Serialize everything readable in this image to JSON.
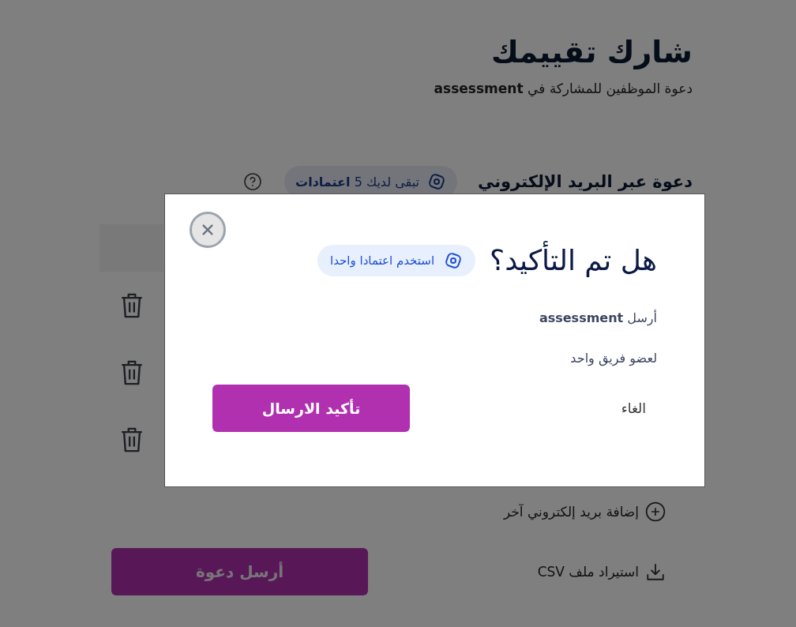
{
  "page": {
    "title": "شارك تقييمك",
    "subtitle": "دعوة الموظفين للمشاركة في **assessment**"
  },
  "email_section": {
    "heading": "دعوة عبر البريد الإلكتروني",
    "credits_badge": "تبقى لديك 5 **اعتمادات**",
    "rows": [
      {
        "kind": "header"
      },
      {
        "kind": "email"
      },
      {
        "kind": "email"
      },
      {
        "kind": "email"
      }
    ],
    "add_link": "إضافة بريد إلكتروني آخر",
    "import_link": "استيراد ملف CSV",
    "send_button": "أرسل دعوة"
  },
  "dialog": {
    "title": "هل تم التأكيد؟",
    "credit_badge": "استخدم اعتمادا واحدا",
    "lines": [
      "أرسل **assessment**",
      "لعضو فريق واحد"
    ],
    "cancel": "الغاء",
    "confirm": "تأكيد الارسال"
  }
}
